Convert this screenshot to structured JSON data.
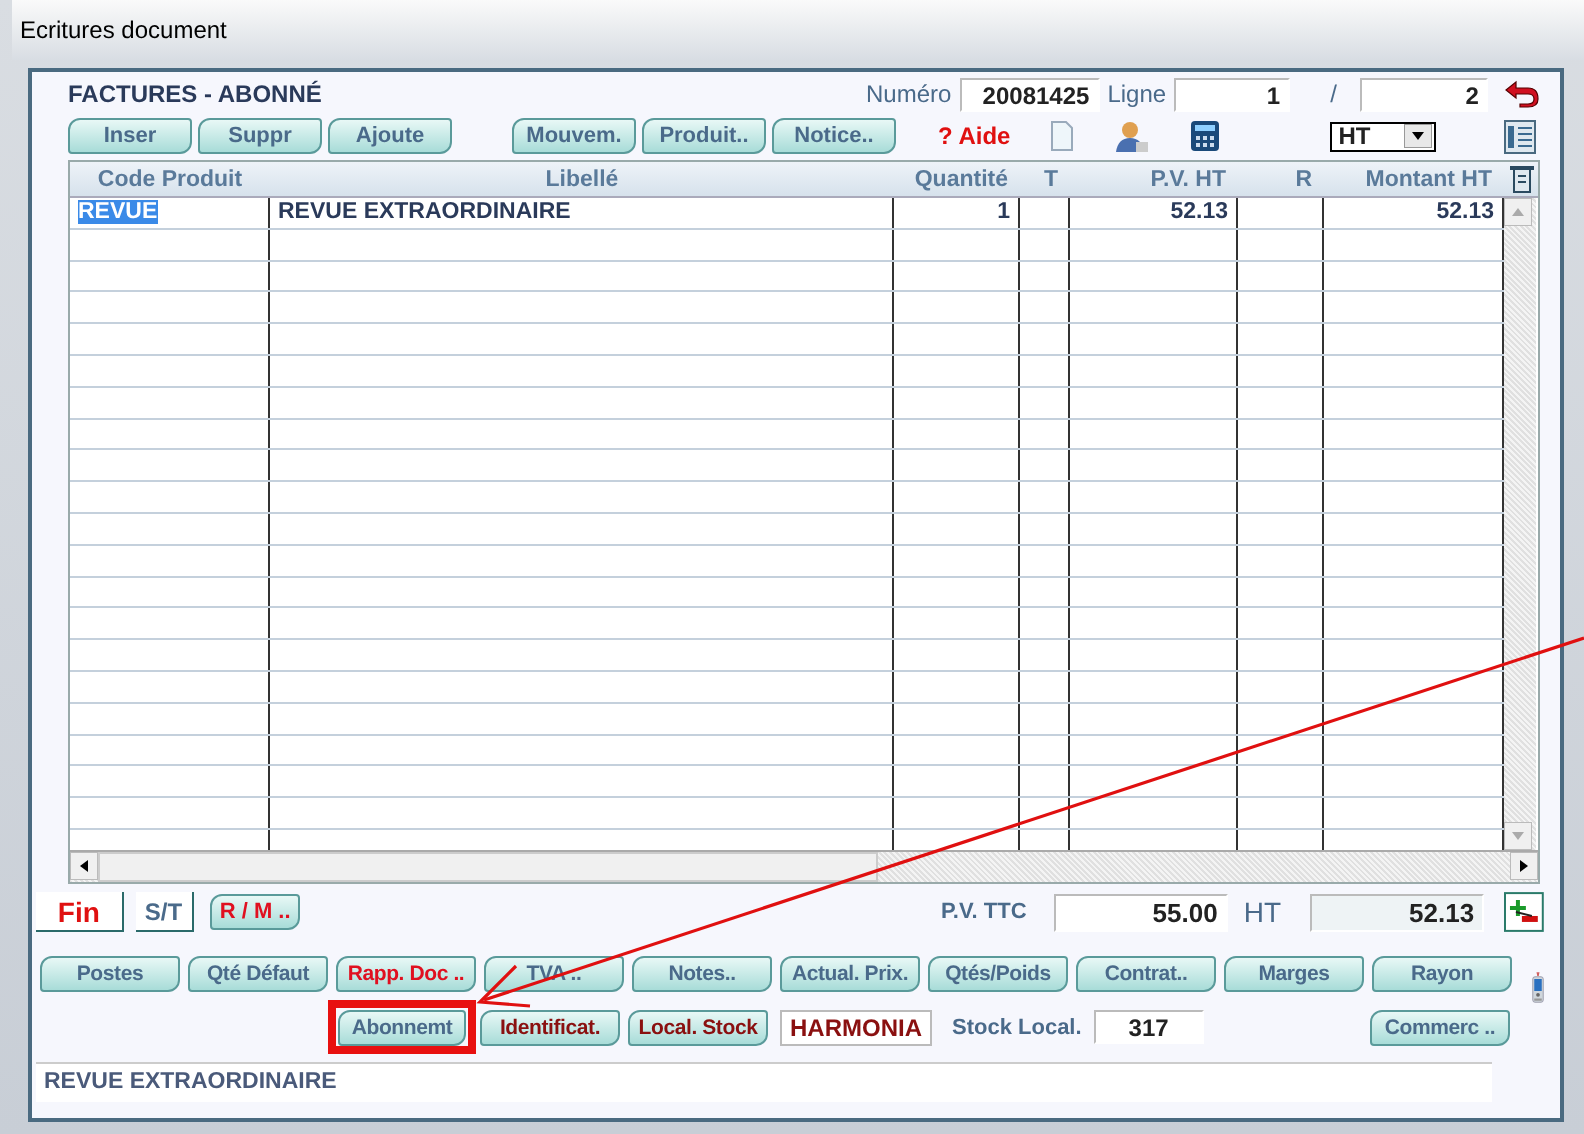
{
  "window": {
    "title": "Ecritures document"
  },
  "header": {
    "title": "FACTURES - ABONNÉ",
    "numero_label": "Numéro",
    "numero": "20081425",
    "ligne_label": "Ligne",
    "ligne": "1",
    "separator": "/",
    "total": "2"
  },
  "toolbar": {
    "edit_buttons": [
      "Inser",
      "Suppr",
      "Ajoute"
    ],
    "view_buttons": [
      "Mouvem.",
      "Produit..",
      "Notice.."
    ],
    "help": "? Aide",
    "select": {
      "value": "HT"
    }
  },
  "table": {
    "columns": [
      "Code Produit",
      "Libellé",
      "Quantité",
      "T",
      "P.V. HT",
      "R",
      "Montant HT"
    ],
    "rows": [
      [
        "REVUE",
        "REVUE EXTRAORDINAIRE",
        "1",
        "",
        "52.13",
        "",
        "52.13"
      ]
    ]
  },
  "totals": {
    "fin": "Fin",
    "st": "S/T",
    "rm": "R / M ..",
    "pv_ttc_label": "P.V. TTC",
    "pv_ttc": "55.00",
    "ht_label": "HT",
    "ht": "52.13"
  },
  "buttons_row1": [
    {
      "label": "Postes",
      "kind": "plain",
      "highlighted": false
    },
    {
      "label": "Qté Défaut",
      "kind": "plain",
      "highlighted": false
    },
    {
      "label": "Rapp. Doc ..",
      "kind": "red",
      "highlighted": false
    },
    {
      "label": "TVA ..",
      "kind": "plain",
      "highlighted": false
    },
    {
      "label": "Notes..",
      "kind": "plain",
      "highlighted": false
    },
    {
      "label": "Actual. Prix.",
      "kind": "plain",
      "highlighted": false
    },
    {
      "label": "Qtés/Poids",
      "kind": "plain",
      "highlighted": false
    },
    {
      "label": "Contrat..",
      "kind": "plain",
      "highlighted": false
    },
    {
      "label": "Marges",
      "kind": "plain",
      "highlighted": false
    },
    {
      "label": "Rayon",
      "kind": "plain",
      "highlighted": false
    }
  ],
  "buttons_row2": [
    {
      "label": "Abonnemt",
      "kind": "plain",
      "highlighted": true
    },
    {
      "label": "Identificat.",
      "kind": "maroon",
      "highlighted": false
    },
    {
      "label": "Local. Stock",
      "kind": "maroon",
      "highlighted": false
    }
  ],
  "store": "HARMONIA",
  "stock_label": "Stock Local.",
  "stock": "317",
  "commerce_button": "Commerc ..",
  "footer": "REVUE EXTRAORDINAIRE"
}
